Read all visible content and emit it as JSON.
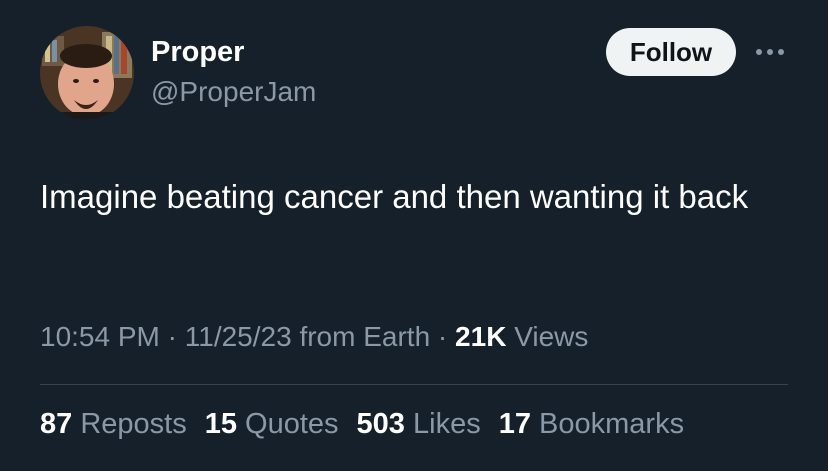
{
  "author": {
    "name": "Proper",
    "handle": "@ProperJam",
    "avatar_icon": "profile-photo"
  },
  "follow_label": "Follow",
  "more_icon": "more-horizontal-icon",
  "tweet": {
    "text": "Imagine beating cancer and then wanting it back"
  },
  "meta": {
    "time": "10:54 PM",
    "sep1": " · ",
    "date": "11/25/23",
    "source": " from Earth",
    "sep2": " · ",
    "views_count": "21K",
    "views_label": " Views"
  },
  "stats": [
    {
      "count": "87",
      "label": " Reposts"
    },
    {
      "count": "15",
      "label": " Quotes"
    },
    {
      "count": "503",
      "label": " Likes"
    },
    {
      "count": "17",
      "label": " Bookmarks"
    }
  ],
  "colors": {
    "background": "#15202b",
    "secondary_text": "#8b98a5",
    "button_bg": "#eff3f4",
    "divider": "#38444d"
  }
}
